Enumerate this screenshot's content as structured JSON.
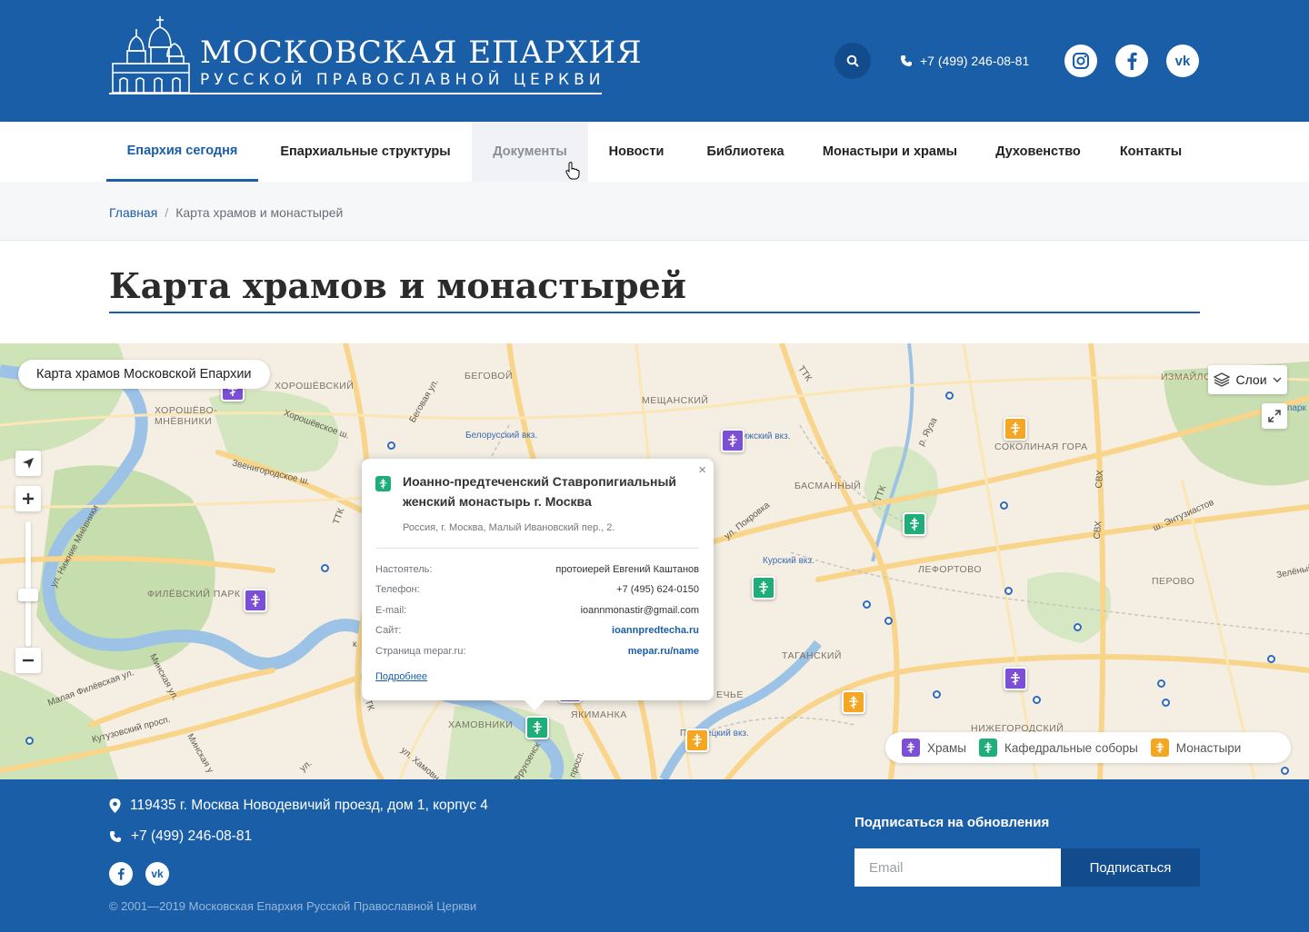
{
  "header": {
    "logo_title": "МОСКОВСКАЯ ЕПАРХИЯ",
    "logo_subtitle": "РУССКОЙ ПРАВОСЛАВНОЙ ЦЕРКВИ",
    "phone": "+7 (499) 246-08-81",
    "social": [
      "instagram-icon",
      "facebook-icon",
      "vk-icon"
    ]
  },
  "nav": {
    "items": [
      {
        "label": "Епархия сегодня"
      },
      {
        "label": "Епархиальные структуры"
      },
      {
        "label": "Документы"
      },
      {
        "label": "Новости"
      },
      {
        "label": "Библиотека"
      },
      {
        "label": "Монастыри и храмы"
      },
      {
        "label": "Духовенство"
      },
      {
        "label": "Контакты"
      }
    ]
  },
  "breadcrumb": {
    "home": "Главная",
    "separator": "/",
    "current": "Карта храмов и монастырей"
  },
  "page": {
    "title": "Карта храмов и монастырей"
  },
  "map": {
    "title": "Карта храмов Московской Епархии",
    "layers_label": "Слои",
    "districts": [
      "БЕГОВОЙ",
      "ХОРОШЁВСКИЙ",
      "ХОРОШЁВО-",
      "МНЁВНИКИ",
      "МЕЩАНСКИЙ",
      "БАСМАННЫЙ",
      "СОКОЛИНАЯ ГОРА",
      "ИЗМАЙЛО",
      "ЛЕФОРТОВО",
      "ПЕРОВО",
      "ФИЛЁВСКИЙ ПАРК",
      "ТАГАНСКИЙ",
      "ХАМОВНИКИ",
      "ЯКИМАНКА",
      "НИЖЕГОРОДСКИЙ",
      "ЕЧЬЕ"
    ],
    "streets": [
      "Беговая ул.",
      "Хорошёвское ш.",
      "Звенигородское ш.",
      "ул. Нижние Мнёвники",
      "ТТК",
      "ул. Покровка",
      "р. Яуза",
      "СВХ",
      "ш. Энтузиастов",
      "Зелёный",
      "Малая Филёвская ул.",
      "Минская ул.",
      "Кутузовский просп.",
      "Минская у",
      "ул. Хамовн",
      "Фрунзенск",
      "просп.",
      "ул.",
      "к"
    ],
    "stations": [
      "Белорусский вкз.",
      "Рижский вкз.",
      "Курский вкз.",
      "Павелецкий вкз."
    ],
    "legend": [
      {
        "label": "Храмы",
        "color": "#7b4fd6"
      },
      {
        "label": "Кафедральные соборы",
        "color": "#1fae7a"
      },
      {
        "label": "Монастыри",
        "color": "#f5a623"
      }
    ],
    "popup": {
      "title": "Иоанно-предтеченский Ставропигиальный женский монастырь г. Москва",
      "address": "Россия, г. Москва, Малый Ивановский пер., 2.",
      "close": "×",
      "rows": [
        {
          "key": "Настоятель:",
          "value": "протоиерей Евгений Каштанов"
        },
        {
          "key": "Телефон:",
          "value": "+7 (495) 624-0150"
        },
        {
          "key": "E-mail:",
          "value": "ioannmonastir@gmail.com"
        },
        {
          "key": "Сайт:",
          "value": "ioannpredtecha.ru"
        },
        {
          "key": "Страница mepar.ru:",
          "value": "mepar.ru/name"
        }
      ],
      "more": "Подробнее"
    },
    "park_text": "парк"
  },
  "footer": {
    "address": "119435 г. Москва Новодевичий проезд, дом 1, корпус 4",
    "phone": "+7 (499) 246-08-81",
    "copyright": "© 2001—2019  Московская Епархия Русской Православной Церкви",
    "subscribe_title": "Подписаться на обновления",
    "email_placeholder": "Email",
    "subscribe_button": "Подписаться"
  },
  "colors": {
    "brand": "#1a5ea8",
    "brand_dark": "#134c8c",
    "hram": "#7b4fd6",
    "sobor": "#1fae7a",
    "monastery": "#f5a623"
  }
}
